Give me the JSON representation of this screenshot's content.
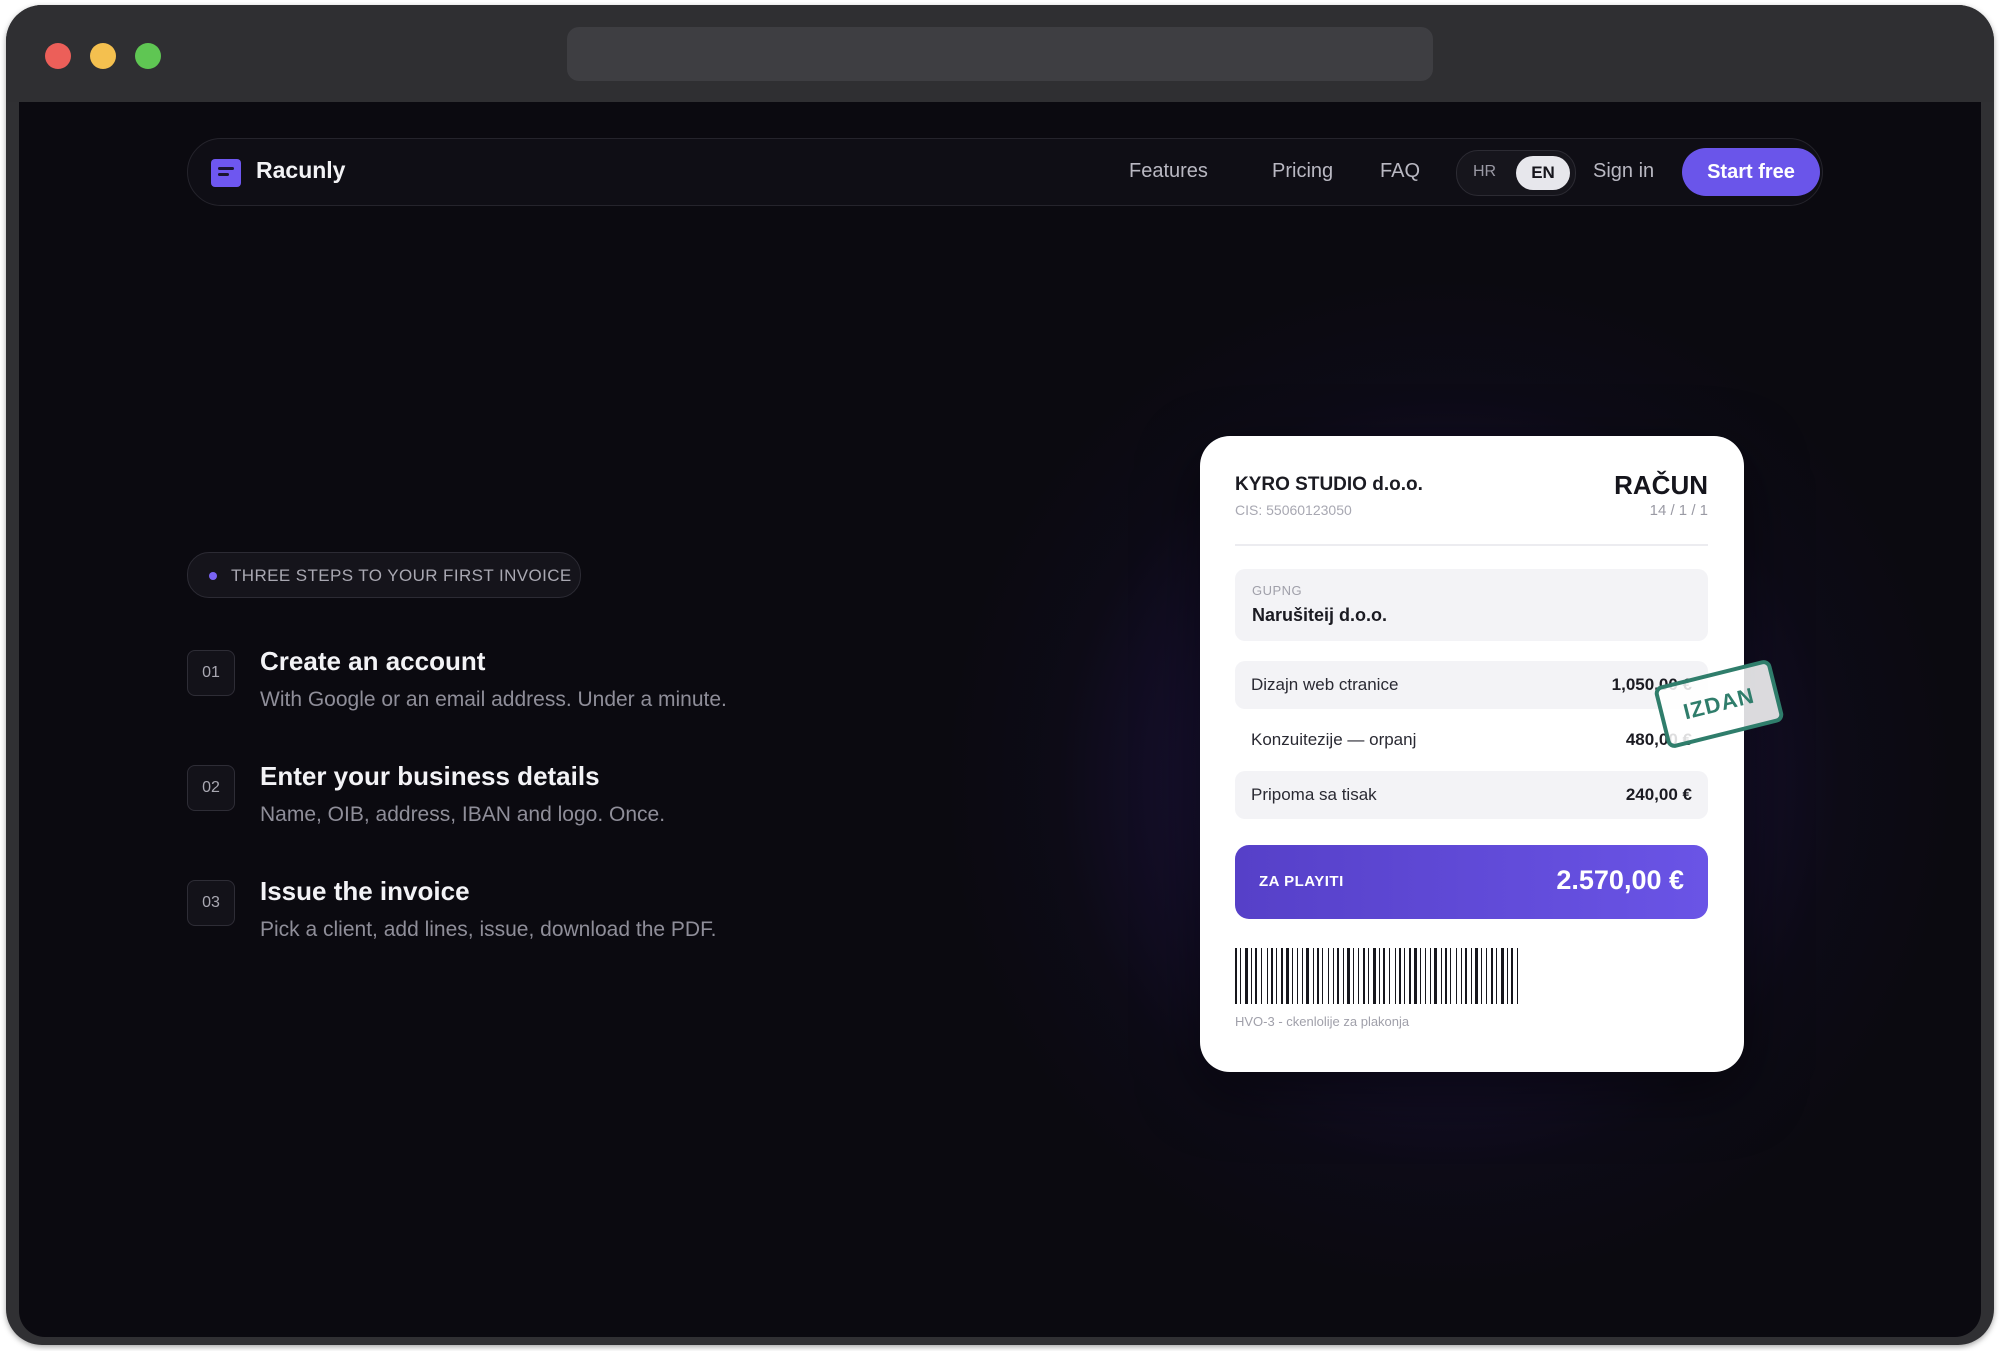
{
  "nav": {
    "brand": "Racunly",
    "links": [
      "Features",
      "Pricing",
      "FAQ"
    ],
    "lang_options": [
      "HR",
      "EN"
    ],
    "active_lang": "EN",
    "sign_in": "Sign in",
    "cta": "Start free"
  },
  "hero": {
    "badge": "THREE STEPS TO YOUR FIRST INVOICE",
    "steps": [
      {
        "num": "01",
        "title": "Create an account",
        "desc": "With Google or an email address. Under a minute."
      },
      {
        "num": "02",
        "title": "Enter your business details",
        "desc": "Name, OIB, address, IBAN and logo. Once."
      },
      {
        "num": "03",
        "title": "Issue the invoice",
        "desc": "Pick a client, add lines, issue, download the PDF."
      }
    ]
  },
  "invoice": {
    "company": "KYRO STUDIO d.o.o.",
    "cis": "CIS: 55060123050",
    "title": "RAČUN",
    "number": "14 / 1 / 1",
    "client_label": "GUPNG",
    "client_name": "Narušiteij d.o.o.",
    "stamp": "IZDAN",
    "lines": [
      {
        "desc": "Dizajn web ctranice",
        "amount": "1,050,00 €"
      },
      {
        "desc": "Konzuitezije — orpanj",
        "amount": "480,00 €"
      },
      {
        "desc": "Pripoma sa tisak",
        "amount": "240,00 €"
      }
    ],
    "total_label": "ZA PLAYITI",
    "total_amount": "2.570,00 €",
    "barcode_caption": "HVO-3 - ckenlolije za plakonja"
  },
  "colors": {
    "accent": "#6a55ea",
    "background": "#0b0a10",
    "stamp": "#2f7d6b"
  }
}
